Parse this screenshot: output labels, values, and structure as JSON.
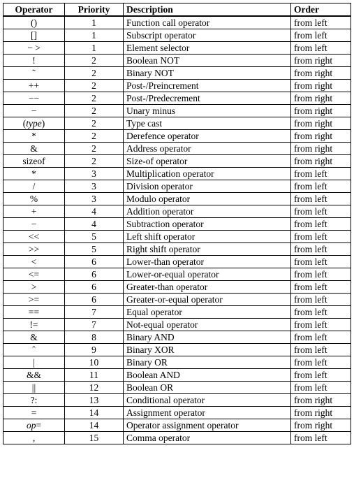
{
  "headers": {
    "operator": "Operator",
    "priority": "Priority",
    "description": "Description",
    "order": "Order"
  },
  "rows": [
    {
      "op": "()",
      "pri": "1",
      "desc": "Function call operator",
      "ord": "from left"
    },
    {
      "op": "[]",
      "pri": "1",
      "desc": "Subscript operator",
      "ord": "from left"
    },
    {
      "op": "− >",
      "pri": "1",
      "desc": "Element selector",
      "ord": "from left"
    },
    {
      "op": "!",
      "pri": "2",
      "desc": "Boolean NOT",
      "ord": "from right"
    },
    {
      "op": "˜",
      "pri": "2",
      "desc": "Binary NOT",
      "ord": "from right"
    },
    {
      "op": "++",
      "pri": "2",
      "desc": "Post-/Preincrement",
      "ord": "from right"
    },
    {
      "op": "−−",
      "pri": "2",
      "desc": "Post-/Predecrement",
      "ord": "from right"
    },
    {
      "op": "−",
      "pri": "2",
      "desc": "Unary minus",
      "ord": "from right"
    },
    {
      "op_html": "(<span class='italic'>type</span>)",
      "pri": "2",
      "desc": "Type cast",
      "ord": "from right"
    },
    {
      "op": "*",
      "pri": "2",
      "desc": "Derefence operator",
      "ord": "from right"
    },
    {
      "op": "&",
      "pri": "2",
      "desc": "Address operator",
      "ord": "from right"
    },
    {
      "op": "sizeof",
      "pri": "2",
      "desc": "Size-of operator",
      "ord": "from right"
    },
    {
      "op": "*",
      "pri": "3",
      "desc": "Multiplication operator",
      "ord": "from left"
    },
    {
      "op": "/",
      "pri": "3",
      "desc": "Division operator",
      "ord": "from left"
    },
    {
      "op": "%",
      "pri": "3",
      "desc": "Modulo operator",
      "ord": "from left"
    },
    {
      "op": "+",
      "pri": "4",
      "desc": "Addition operator",
      "ord": "from left"
    },
    {
      "op": "−",
      "pri": "4",
      "desc": "Subtraction operator",
      "ord": "from left"
    },
    {
      "op": "<<",
      "pri": "5",
      "desc": "Left shift operator",
      "ord": "from left"
    },
    {
      "op": ">>",
      "pri": "5",
      "desc": "Right shift operator",
      "ord": "from left"
    },
    {
      "op": "<",
      "pri": "6",
      "desc": "Lower-than operator",
      "ord": "from left"
    },
    {
      "op": "<=",
      "pri": "6",
      "desc": "Lower-or-equal operator",
      "ord": "from left"
    },
    {
      "op": ">",
      "pri": "6",
      "desc": "Greater-than operator",
      "ord": "from left"
    },
    {
      "op": ">=",
      "pri": "6",
      "desc": "Greater-or-equal operator",
      "ord": "from left"
    },
    {
      "op": "==",
      "pri": "7",
      "desc": "Equal operator",
      "ord": "from left"
    },
    {
      "op": "!=",
      "pri": "7",
      "desc": "Not-equal operator",
      "ord": "from left"
    },
    {
      "op": "&",
      "pri": "8",
      "desc": "Binary AND",
      "ord": "from left"
    },
    {
      "op": "ˆ",
      "pri": "9",
      "desc": "Binary XOR",
      "ord": "from left"
    },
    {
      "op": "|",
      "pri": "10",
      "desc": "Binary OR",
      "ord": "from left"
    },
    {
      "op": "&&",
      "pri": "11",
      "desc": "Boolean AND",
      "ord": "from left"
    },
    {
      "op": "||",
      "pri": "12",
      "desc": "Boolean OR",
      "ord": "from left"
    },
    {
      "op": "?:",
      "pri": "13",
      "desc": "Conditional operator",
      "ord": "from right"
    },
    {
      "op": "=",
      "pri": "14",
      "desc": "Assignment operator",
      "ord": "from right"
    },
    {
      "op_html": "<span class='italic'>op</span>=",
      "pri": "14",
      "desc": "Operator assignment operator",
      "ord": "from right"
    },
    {
      "op": ",",
      "pri": "15",
      "desc": "Comma operator",
      "ord": "from left"
    }
  ]
}
